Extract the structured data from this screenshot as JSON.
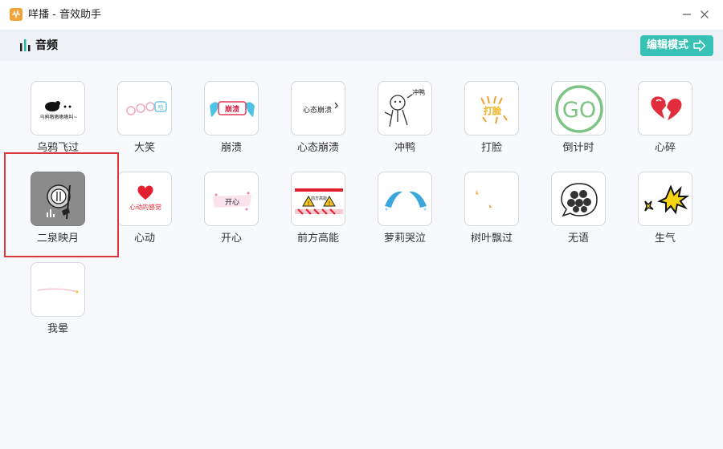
{
  "window": {
    "title": "咩播 - 音效助手"
  },
  "header": {
    "title": "音频",
    "edit_button": "编辑模式"
  },
  "sounds": [
    {
      "label": "乌鸦飞过",
      "thumb_text": "乌鸦嗷嗷嗷嗷叫~",
      "icon": "crow-icon"
    },
    {
      "label": "大笑",
      "thumb_text": "哈",
      "icon": "laugh-icon"
    },
    {
      "label": "崩溃",
      "thumb_text": "崩溃",
      "icon": "breakdown-icon"
    },
    {
      "label": "心态崩溃",
      "thumb_text": "心态崩溃",
      "icon": "mental-breakdown-icon"
    },
    {
      "label": "冲鸭",
      "thumb_text": "冲鸭",
      "icon": "charge-duck-icon"
    },
    {
      "label": "打脸",
      "thumb_text": "打脸",
      "icon": "face-slap-icon"
    },
    {
      "label": "倒计时",
      "thumb_text": "GO",
      "icon": "countdown-icon"
    },
    {
      "label": "心碎",
      "thumb_text": "",
      "icon": "broken-heart-icon"
    },
    {
      "label": "二泉映月",
      "thumb_text": "",
      "icon": "erhu-icon",
      "selected": true
    },
    {
      "label": "心动",
      "thumb_text": "心动的感觉",
      "icon": "heartbeat-icon"
    },
    {
      "label": "开心",
      "thumb_text": "开心",
      "icon": "happy-icon"
    },
    {
      "label": "前方高能",
      "thumb_text": "前方高能",
      "icon": "warning-icon"
    },
    {
      "label": "萝莉哭泣",
      "thumb_text": "",
      "icon": "crying-icon"
    },
    {
      "label": "树叶飘过",
      "thumb_text": "",
      "icon": "leaf-icon"
    },
    {
      "label": "无语",
      "thumb_text": "",
      "icon": "speechless-icon"
    },
    {
      "label": "生气",
      "thumb_text": "",
      "icon": "angry-icon"
    },
    {
      "label": "我晕",
      "thumb_text": "",
      "icon": "dizzy-icon"
    }
  ],
  "colors": {
    "accent": "#38c2b6",
    "selection_border": "#d9363e",
    "header_bg": "#eef1f5",
    "page_bg": "#f7f9fc"
  }
}
